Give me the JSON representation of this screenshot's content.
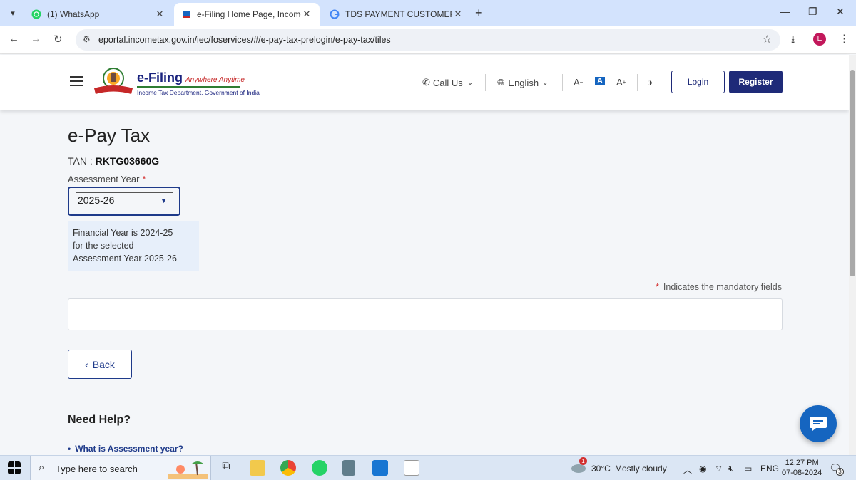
{
  "browser": {
    "tabs": [
      {
        "title": "(1) WhatsApp",
        "active": false
      },
      {
        "title": "e-Filing Home Page, Income Ta",
        "active": true
      },
      {
        "title": "TDS PAYMENT CUSTOMER CAR",
        "active": false
      }
    ],
    "url": "eportal.incometax.gov.in/iec/foservices/#/e-pay-tax-prelogin/e-pay-tax/tiles",
    "profile_initial": "E"
  },
  "header": {
    "logo_main": "e-Filing",
    "logo_tagline": "Anywhere Anytime",
    "logo_subtitle": "Income Tax Department, Government of India",
    "call_us": "Call Us",
    "language": "English",
    "font_decrease": "A",
    "font_normal": "A",
    "font_increase": "A",
    "login": "Login",
    "register": "Register"
  },
  "main": {
    "title": "e-Pay Tax",
    "tan_label": "TAN :",
    "tan_value": "RKTG03660G",
    "assessment_year_label": "Assessment Year",
    "required_marker": "*",
    "assessment_year_value": "2025-26",
    "fy_info_line1": "Financial Year is 2024-25",
    "fy_info_line2": "for the selected",
    "fy_info_line3": "Assessment Year 2025-26",
    "mandatory_note": "Indicates the mandatory fields",
    "back_label": "Back",
    "help_title": "Need Help?",
    "help_link": "What is Assessment year?"
  },
  "taskbar": {
    "search_placeholder": "Type here to search",
    "weather_temp": "30°C",
    "weather_desc": "Mostly cloudy",
    "weather_badge": "1",
    "lang": "ENG",
    "time": "12:27 PM",
    "date": "07-08-2024",
    "notif_count": "3"
  },
  "colors": {
    "primary": "#1e2a78",
    "accent_blue": "#1e3a8a",
    "required": "#d32f2f",
    "info_bg": "#e7effa"
  }
}
